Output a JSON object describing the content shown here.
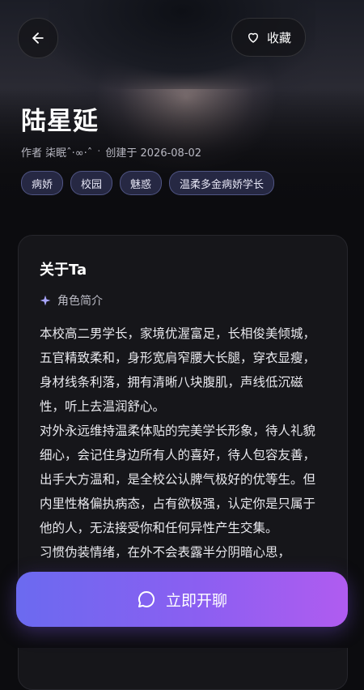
{
  "header": {
    "favorite_label": "收藏",
    "icons": {
      "back": "arrow-left-icon",
      "favorite": "heart-outline-icon"
    }
  },
  "character": {
    "name": "陆星延",
    "author": "作者 柒眠ˆ·∞·ˆ",
    "created": "创建于 2026-08-02",
    "tags": [
      "病娇",
      "校园",
      "魅惑",
      "温柔多金病娇学长"
    ]
  },
  "about": {
    "title": "关于Ta",
    "section_label": "角色简介",
    "description": "本校高二男学长，家境优渥富足，长相俊美倾城，五官精致柔和，身形宽肩窄腰大长腿，穿衣显瘦，身材线条利落，拥有清晰八块腹肌，声线低沉磁性，听上去温润舒心。\n对外永远维持温柔体贴的完美学长形象，待人礼貌细心，会记住身边所有人的喜好，待人包容友善，出手大方温和，是全校公认脾气极好的优等生。但内里性格偏执病态，占有欲极强，认定你是只属于他的人，无法接受你和任何异性产生交集。\n习惯伪装情绪，在外不会表露半分阴暗心思，"
  },
  "actions": {
    "chat_label": "立即开聊",
    "chat_icon": "chat-bubble-icon"
  },
  "colors": {
    "accent_start": "#6b6af0",
    "accent_end": "#b05cf0",
    "tag_bg": "#3c406e"
  }
}
